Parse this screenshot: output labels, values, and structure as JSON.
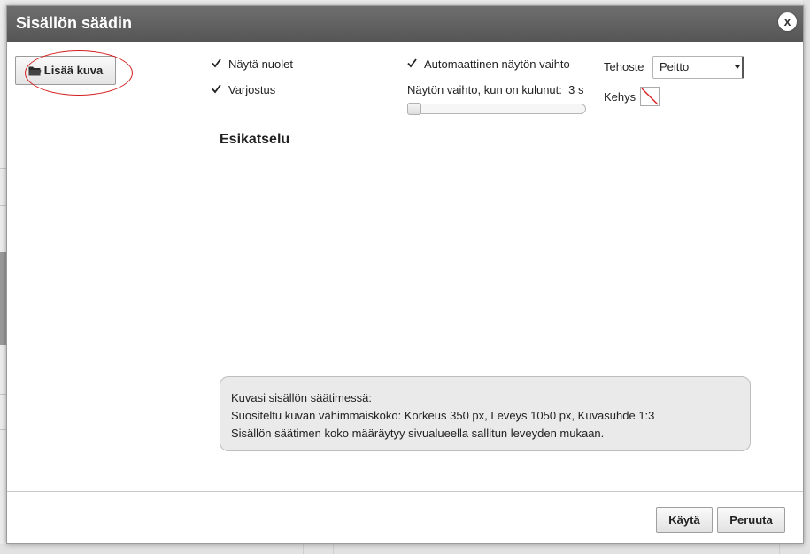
{
  "dialog": {
    "title": "Sisällön säädin",
    "close_label": "x"
  },
  "toolbar": {
    "add_image_label": "Lisää kuva"
  },
  "options": {
    "show_arrows": {
      "label": "Näytä nuolet",
      "checked": true
    },
    "shadow": {
      "label": "Varjostus",
      "checked": true
    },
    "auto_switch": {
      "label": "Automaattinen näytön vaihto",
      "checked": true
    },
    "interval_label": "Näytön vaihto, kun on kulunut:",
    "interval_value": "3 s",
    "interval_slider_fraction": 0.0
  },
  "effect": {
    "label": "Tehoste",
    "selected": "Peitto"
  },
  "frame": {
    "label": "Kehys",
    "value": "none"
  },
  "preview": {
    "heading": "Esikatselu"
  },
  "info": {
    "line1": "Kuvasi sisällön säätimessä:",
    "line2": "Suositeltu kuvan vähimmäiskoko: Korkeus 350 px, Leveys 1050 px, Kuvasuhde 1:3",
    "line3": "Sisällön säätimen koko määräytyy sivualueella sallitun leveyden mukaan."
  },
  "footer": {
    "apply_label": "Käytä",
    "cancel_label": "Peruuta"
  },
  "colors": {
    "titlebar": "#5f5f5f",
    "highlight": "#d42020"
  }
}
